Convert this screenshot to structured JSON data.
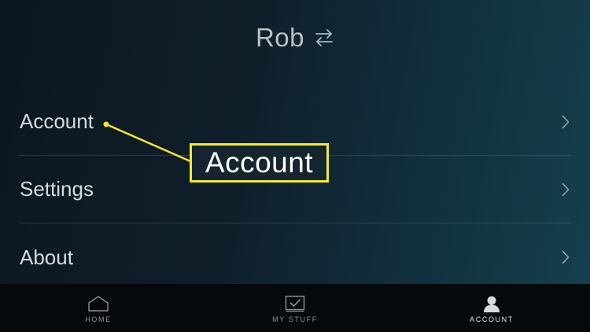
{
  "header": {
    "profile_name": "Rob",
    "switch_icon": "switch-profile-arrows-icon"
  },
  "menu": {
    "items": [
      {
        "label": "Account",
        "icon": "chevron-right-icon"
      },
      {
        "label": "Settings",
        "icon": "chevron-right-icon"
      },
      {
        "label": "About",
        "icon": "chevron-right-icon"
      }
    ]
  },
  "callout": {
    "label": "Account",
    "color": "#f4ea2a"
  },
  "bottom_nav": {
    "items": [
      {
        "label": "HOME",
        "icon": "home-icon",
        "active": false
      },
      {
        "label": "MY STUFF",
        "icon": "my-stuff-check-icon",
        "active": false
      },
      {
        "label": "ACCOUNT",
        "icon": "account-person-icon",
        "active": true
      }
    ]
  },
  "colors": {
    "background": "#0f1f2a",
    "nav_background": "#06090c",
    "callout": "#f4ea2a"
  }
}
